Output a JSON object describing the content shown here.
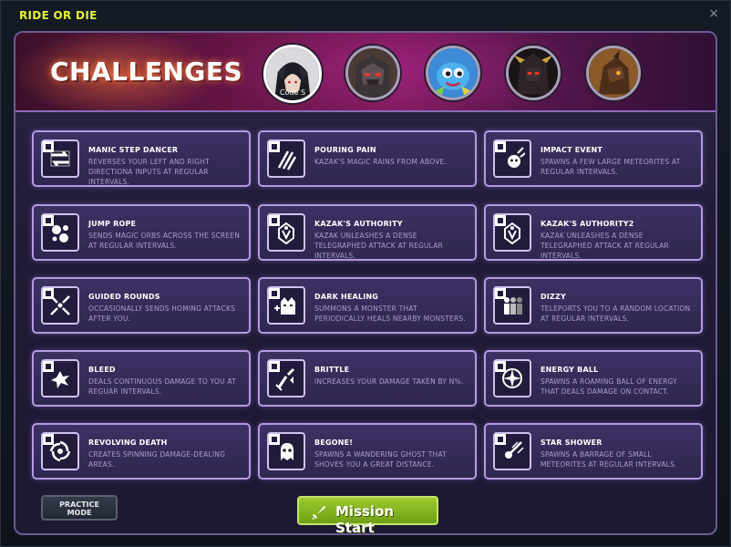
{
  "window": {
    "title": "RIDE OR DIE",
    "close_label": "×"
  },
  "banner": {
    "title": "CHALLENGES",
    "bosses": [
      {
        "caption": "Code S",
        "selected": true,
        "icon": "boss-code-s-portrait"
      },
      {
        "caption": "",
        "selected": false,
        "icon": "boss-stone-golem-portrait"
      },
      {
        "caption": "",
        "selected": false,
        "icon": "boss-blue-creature-portrait"
      },
      {
        "caption": "",
        "selected": false,
        "icon": "boss-dark-armor-portrait"
      },
      {
        "caption": "",
        "selected": false,
        "icon": "boss-dragon-portrait"
      }
    ]
  },
  "challenges": [
    {
      "name": "MANIC STEP DANCER",
      "desc": "REVERSES YOUR LEFT AND RIGHT DIRECTIONA INPUTS AT REGULAR INTERVALS.",
      "icon": "reverse-arrows-icon"
    },
    {
      "name": "POURING PAIN",
      "desc": "KAZAK'S MAGIC RAINS FROM ABOVE.",
      "icon": "claw-slash-icon"
    },
    {
      "name": "IMPACT EVENT",
      "desc": "SPAWNS A FEW LARGE METEORITES AT REGULAR INTERVALS.",
      "icon": "meteor-skull-icon"
    },
    {
      "name": "JUMP ROPE",
      "desc": "SENDS MAGIC ORBS ACROSS THE SCREEN AT REGULAR INTERVALS.",
      "icon": "orbs-icon"
    },
    {
      "name": "KAZAK'S AUTHORITY",
      "desc": "KAZAK UNLEASHES A DENSE TELEGRAPHED ATTACK AT REGULAR INTERVALS.",
      "icon": "kazak-emblem-icon"
    },
    {
      "name": "KAZAK'S AUTHORITY2",
      "desc": "KAZAK UNLEASHES A DENSE TELEGRAPHED ATTACK AT REGULAR INTERVALS.",
      "icon": "kazak-emblem-icon"
    },
    {
      "name": "GUIDED ROUNDS",
      "desc": "OCCASIONALLY SENDS HOMING ATTACKS AFTER YOU.",
      "icon": "homing-arrows-icon"
    },
    {
      "name": "DARK HEALING",
      "desc": "SUMMONS A MONSTER THAT PERIODICALLY HEALS NEARBY MONSTERS.",
      "icon": "monster-heal-icon"
    },
    {
      "name": "DIZZY",
      "desc": "TELEPORTS YOU TO A RANDOM LOCATION AT REGULAR INTERVALS.",
      "icon": "teleport-figures-icon"
    },
    {
      "name": "BLEED",
      "desc": "DEALS CONTINUOUS DAMAGE TO YOU AT REGUAR INTERVALS.",
      "icon": "blood-splash-icon"
    },
    {
      "name": "BRITTLE",
      "desc": "INCREASES YOUR DAMAGE TAKEN BY N%.",
      "icon": "broken-sword-icon"
    },
    {
      "name": "ENERGY BALL",
      "desc": "SPAWNS A ROAMING BALL OF ENERGY THAT DEALS DAMAGE ON CONTACT.",
      "icon": "energy-star-icon"
    },
    {
      "name": "REVOLVING DEATH",
      "desc": "CREATES SPINNING DAMAGE-DEALING AREAS.",
      "icon": "spinning-blades-icon"
    },
    {
      "name": "BEGONE!",
      "desc": "SPAWNS A WANDERING GHOST THAT SHOVES YOU A GREAT DISTANCE.",
      "icon": "ghost-icon"
    },
    {
      "name": "STAR SHOWER",
      "desc": "SPAWNS A BARRAGE OF SMALL METEORITES AT REGULAR INTERVALS.",
      "icon": "falling-stars-icon"
    }
  ],
  "footer": {
    "practice_line1": "PRACTICE",
    "practice_line2": "MODE",
    "mission_label": "Mission Start"
  },
  "colors": {
    "accent": "#e6f03c",
    "card_border": "#b39adf",
    "mission_green": "#8cbc24"
  }
}
